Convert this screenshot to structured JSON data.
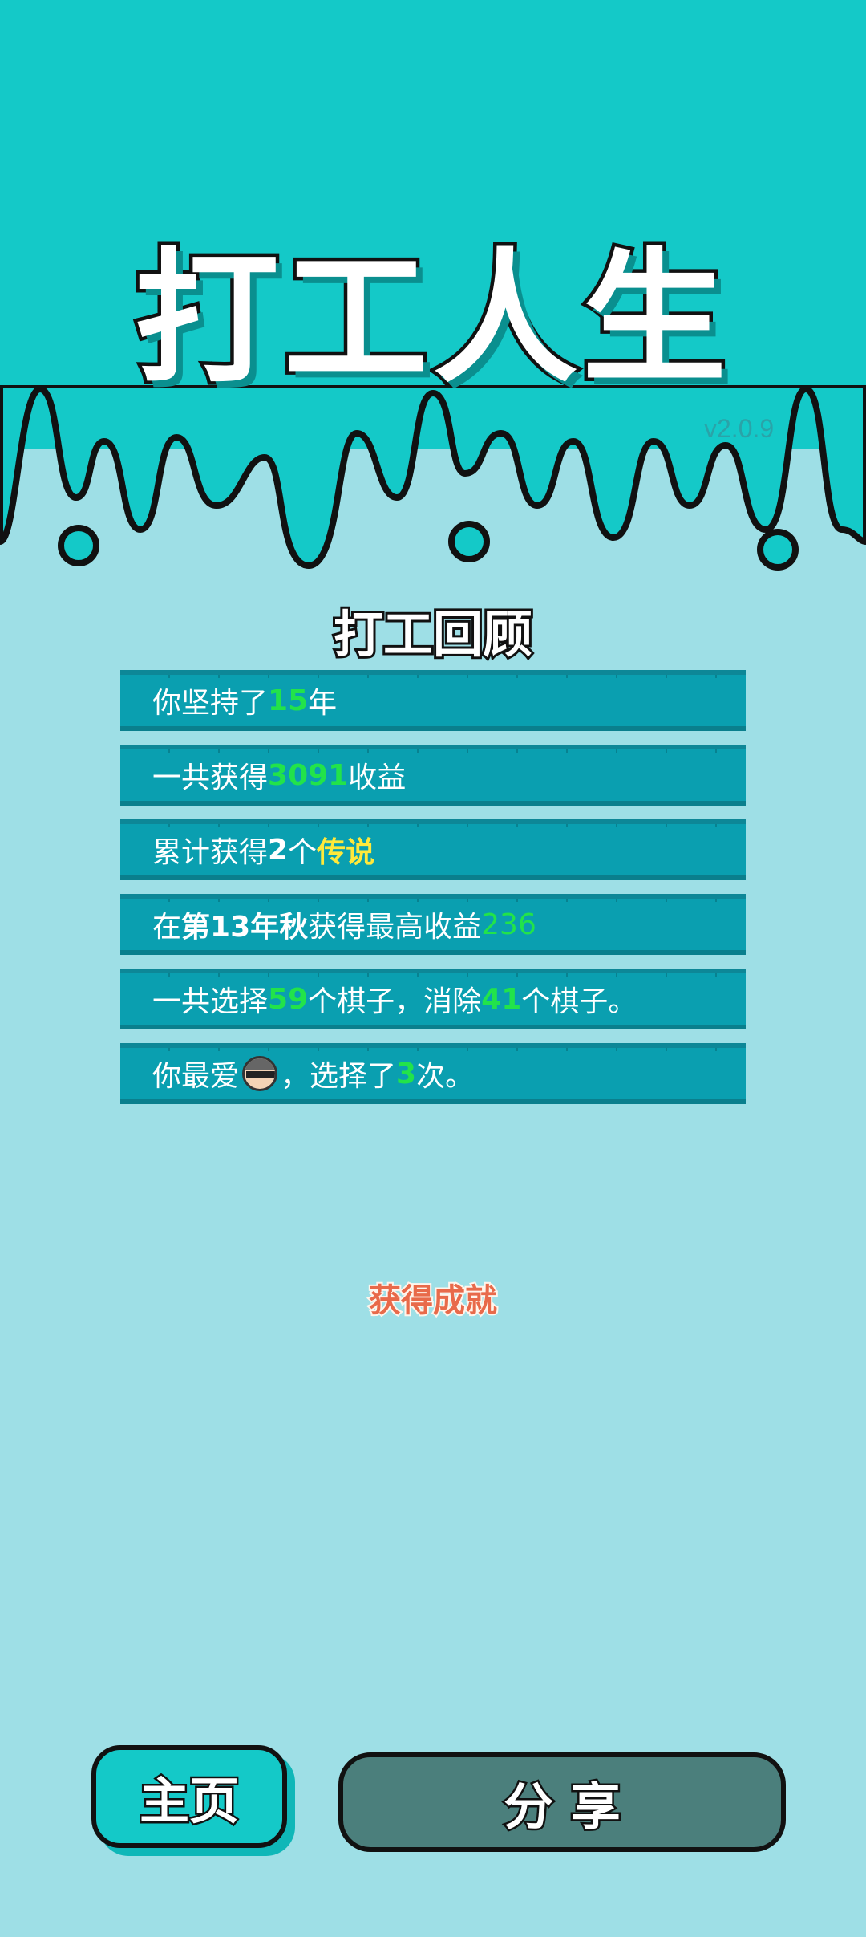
{
  "app": {
    "title": "打工人生",
    "version": "v2.0.9"
  },
  "review": {
    "title": "打工回顾",
    "rows": [
      {
        "pre": "你坚持了",
        "num": "15",
        "post": "年"
      },
      {
        "pre": "一共获得",
        "num": "3091",
        "post": "收益"
      },
      {
        "pre": "累计获得",
        "num": "2",
        "mid": "个",
        "hl": "传说"
      },
      {
        "pre": "在 ",
        "bold": "第13年秋",
        "mid": " 获得最高收益",
        "num": "236"
      },
      {
        "pre": "一共选择",
        "num1": "59",
        "mid": "个棋子，消除",
        "num2": "41",
        "post": "个棋子。"
      },
      {
        "pre": "你最爱",
        "icon": "thief-icon",
        "mid": "，选择了",
        "num": "3",
        "post": "次。"
      }
    ]
  },
  "achievements": {
    "label": "获得成就"
  },
  "buttons": {
    "home": "主页",
    "share": "分 享"
  },
  "colors": {
    "header": "#14c9c8",
    "background": "#9edfe6",
    "row": "#0a9fb0",
    "highlight_green": "#22e34a",
    "highlight_yellow": "#ffe93a"
  }
}
